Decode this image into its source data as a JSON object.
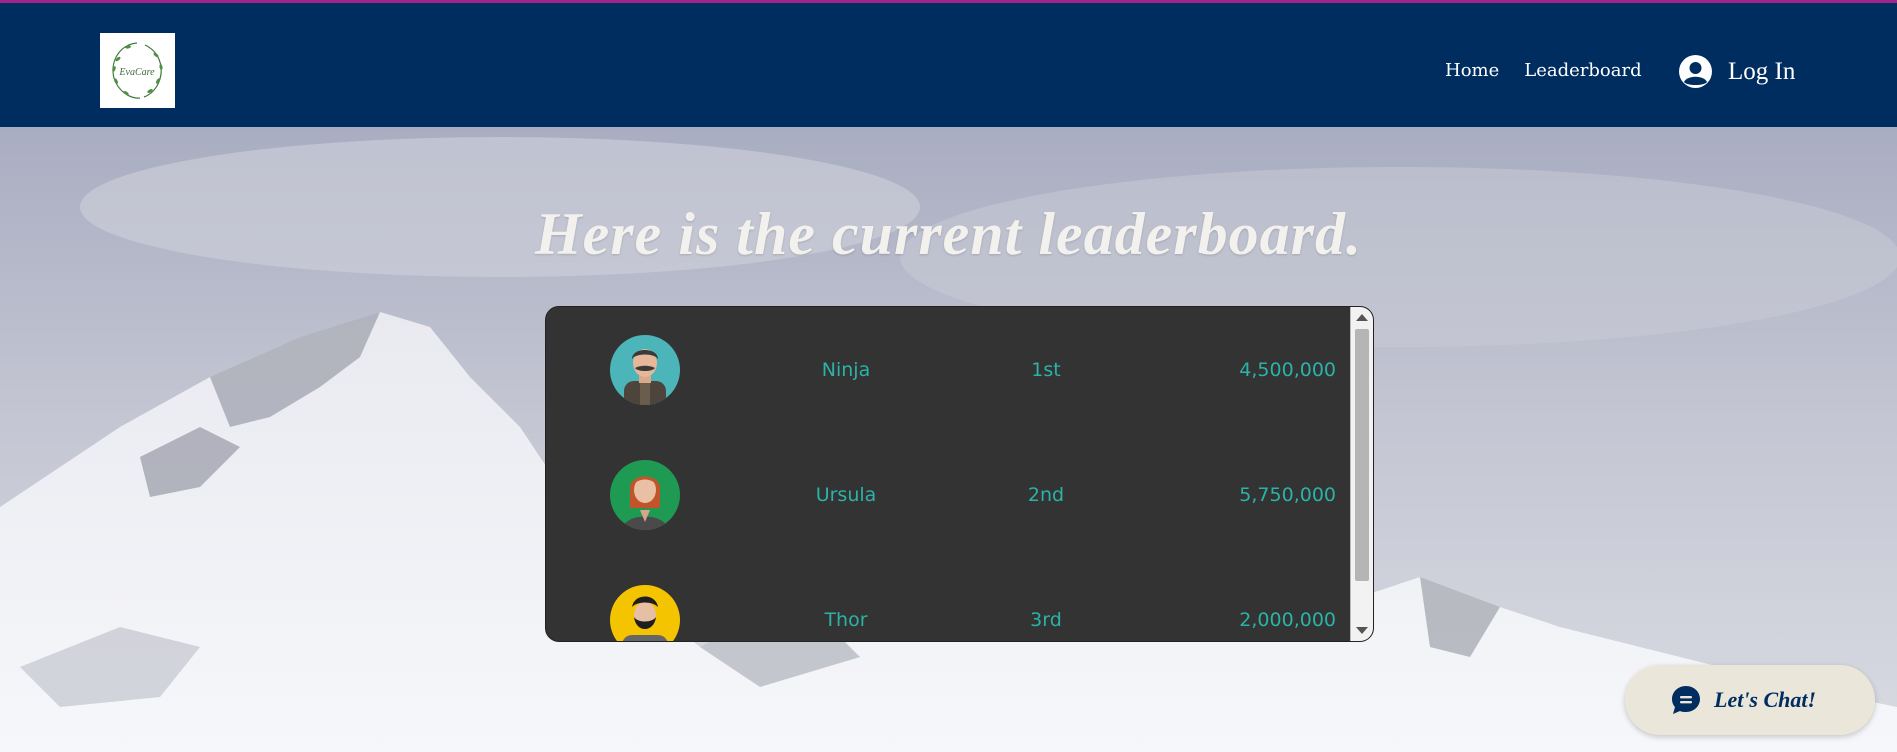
{
  "header": {
    "logo_text": "EvaCare",
    "nav": [
      {
        "label": "Home"
      },
      {
        "label": "Leaderboard"
      }
    ],
    "login_label": "Log In"
  },
  "hero": {
    "title": "Here is the current leaderboard."
  },
  "leaderboard": {
    "rows": [
      {
        "name": "Ninja",
        "rank": "1st",
        "score": "4,500,000",
        "avatar_icon": "man-mustache-avatar-icon",
        "avatar_bg": "#4bb5b9"
      },
      {
        "name": "Ursula",
        "rank": "2nd",
        "score": "5,750,000",
        "avatar_icon": "woman-redhead-avatar-icon",
        "avatar_bg": "#1f9a53"
      },
      {
        "name": "Thor",
        "rank": "3rd",
        "score": "2,000,000",
        "avatar_icon": "man-beard-avatar-icon",
        "avatar_bg": "#f5c400"
      }
    ]
  },
  "chat": {
    "label": "Let's Chat!",
    "icon": "chat-bubble-icon"
  },
  "colors": {
    "header_bg": "#002d60",
    "accent_line": "#a0248c",
    "board_bg": "#333333",
    "board_text": "#2ab3a6",
    "chat_bg": "#ebe6da"
  }
}
